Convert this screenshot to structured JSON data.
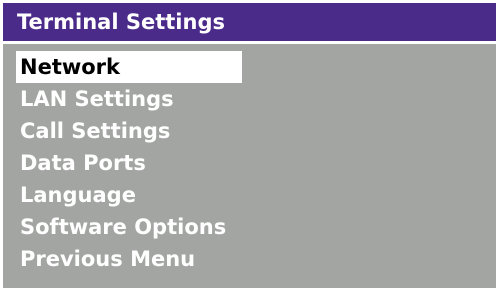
{
  "window": {
    "title": "Terminal Settings"
  },
  "menu": {
    "items": [
      {
        "label": "Network",
        "selected": true
      },
      {
        "label": "LAN Settings",
        "selected": false
      },
      {
        "label": "Call Settings",
        "selected": false
      },
      {
        "label": "Data Ports",
        "selected": false
      },
      {
        "label": "Language",
        "selected": false
      },
      {
        "label": "Software Options",
        "selected": false
      },
      {
        "label": "Previous Menu",
        "selected": false
      }
    ]
  },
  "colors": {
    "title_bar": "#4a2b8a",
    "panel": "#a3a5a3",
    "text": "#ffffff",
    "selection": "#ffffff",
    "selection_text": "#000000"
  }
}
